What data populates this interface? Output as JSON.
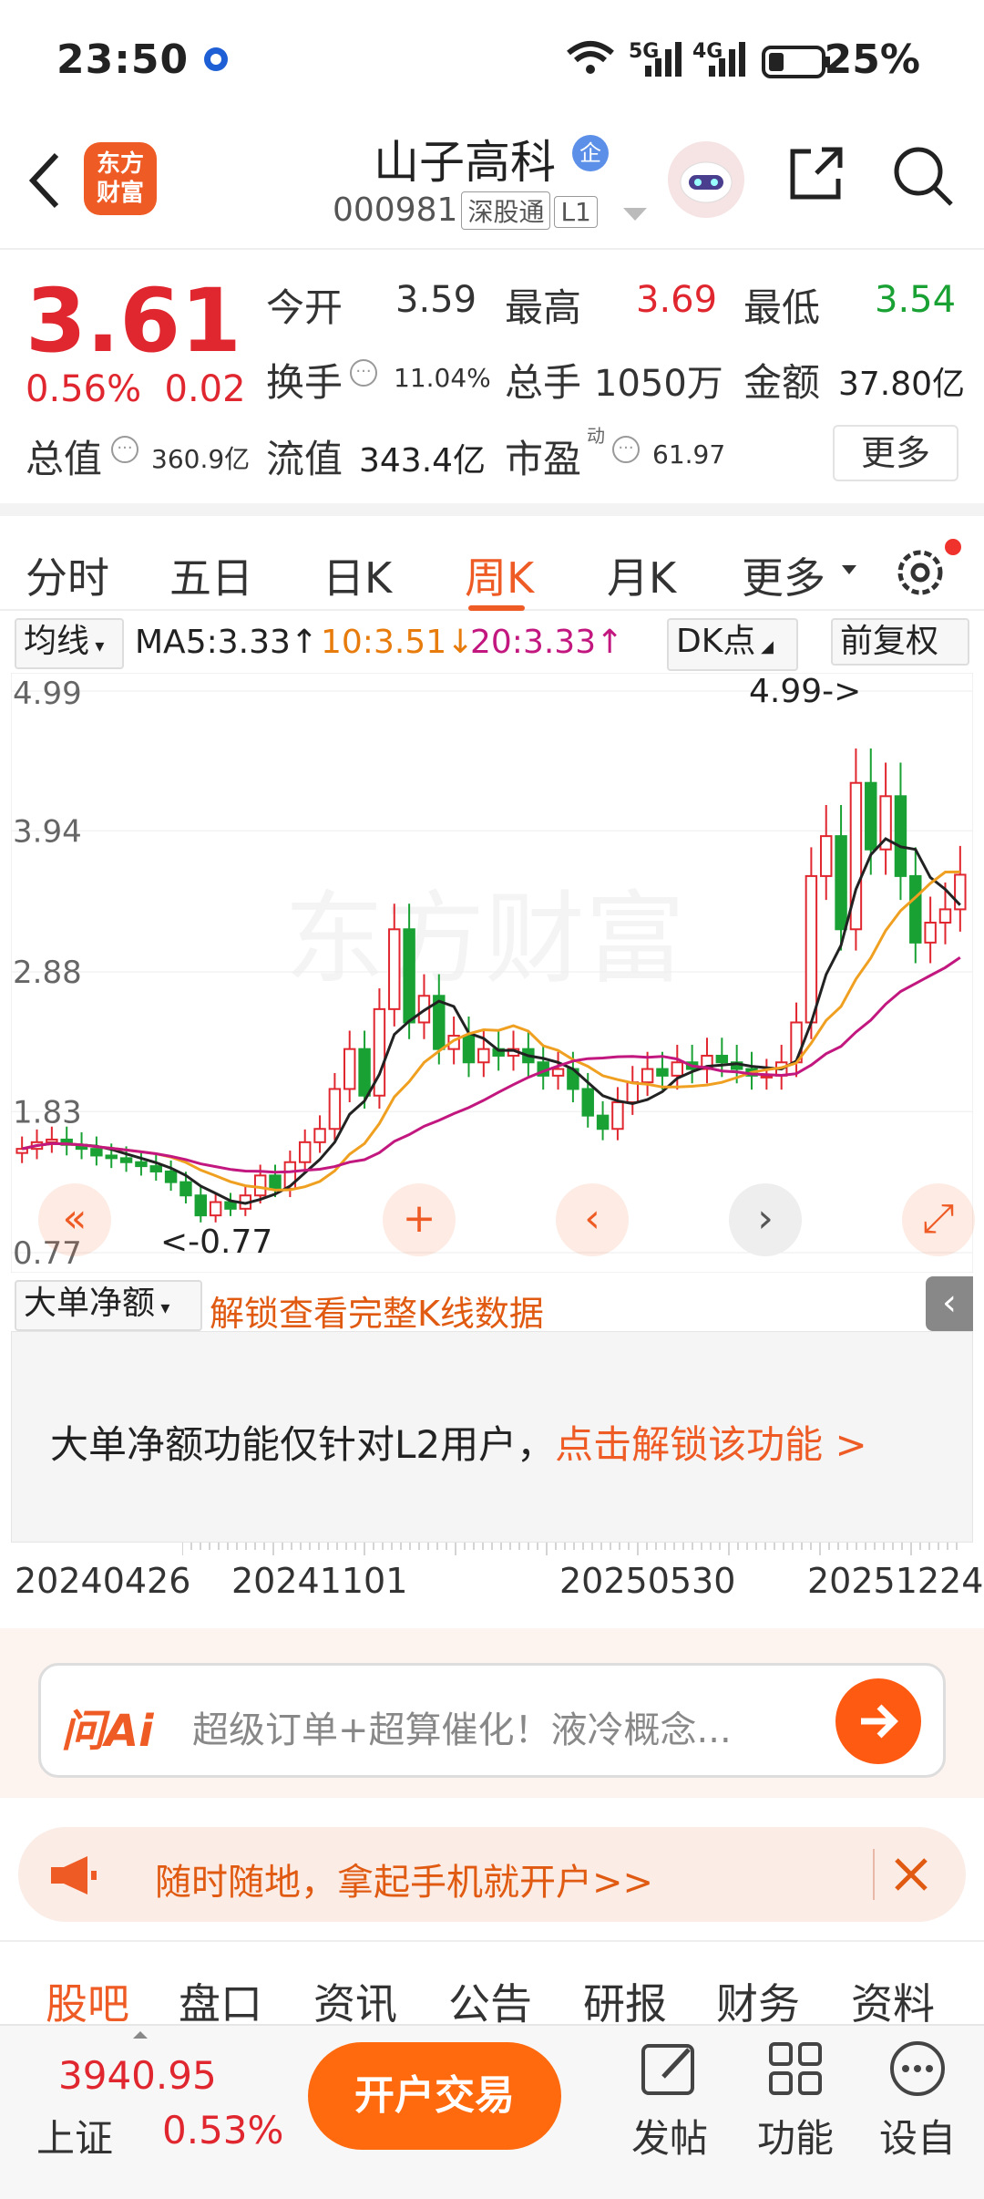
{
  "status_bar": {
    "time": "23:50",
    "battery": "25%",
    "net1": "5G",
    "net2": "4G"
  },
  "header": {
    "logo_text": "东方\n财富",
    "stock_name": "山子高科",
    "stock_name_badge": "企",
    "stock_code": "000981",
    "tag_connect": "深股通",
    "tag_level": "L1"
  },
  "quote": {
    "price": "3.61",
    "change_pct": "0.56%",
    "change": "0.02",
    "open_label": "今开",
    "open": "3.59",
    "high_label": "最高",
    "high": "3.69",
    "low_label": "最低",
    "low": "3.54",
    "turnover_label": "换手",
    "turnover": "11.04%",
    "volume_label": "总手",
    "volume": "1050万",
    "amount_label": "金额",
    "amount": "37.80亿",
    "mcap_label": "总值",
    "mcap": "360.9亿",
    "float_label": "流值",
    "float": "343.4亿",
    "pe_label": "市盈",
    "pe_sup": "动",
    "pe": "61.97",
    "more": "更多"
  },
  "tabs": [
    "分时",
    "五日",
    "日K",
    "周K",
    "月K",
    "更多"
  ],
  "active_tab": "周K",
  "ma_bar": {
    "selector": "均线",
    "ma5": "MA5:3.33↑",
    "ma10": "10:3.51↓",
    "ma20": "20:3.33↑",
    "dk": "DK点",
    "adjust": "前复权"
  },
  "colors": {
    "accent": "#ef5b25",
    "up": "#e0262e",
    "down": "#19a134",
    "ma5": "#222222",
    "ma10": "#f0a020",
    "ma20": "#c2177f"
  },
  "chart_data": {
    "type": "candlestick",
    "y_ticks": [
      "4.99",
      "3.94",
      "2.88",
      "1.83",
      "0.77"
    ],
    "ylim": [
      0.77,
      4.99
    ],
    "max_annotation": "4.99->",
    "min_annotation": "<-0.77",
    "watermark": "东方财富",
    "x_ticks": [
      "20240426",
      "20241101",
      "20250530",
      "20251224"
    ],
    "closes": [
      1.55,
      1.6,
      1.62,
      1.58,
      1.55,
      1.5,
      1.48,
      1.45,
      1.42,
      1.38,
      1.3,
      1.2,
      1.05,
      1.15,
      1.1,
      1.2,
      1.35,
      1.25,
      1.45,
      1.6,
      1.7,
      2.0,
      2.3,
      1.95,
      2.6,
      3.2,
      2.5,
      2.7,
      2.3,
      2.4,
      2.2,
      2.3,
      2.25,
      2.3,
      2.2,
      2.1,
      2.15,
      2.0,
      1.8,
      1.7,
      1.9,
      2.05,
      2.15,
      2.1,
      2.2,
      2.15,
      2.25,
      2.2,
      2.15,
      2.1,
      2.1,
      2.2,
      2.5,
      3.6,
      3.9,
      3.2,
      4.3,
      3.8,
      4.2,
      3.6,
      3.1,
      3.25,
      3.35,
      3.61
    ],
    "ma5_shape": "line",
    "ma10_shape": "line",
    "ma20_shape": "line"
  },
  "big_deal": {
    "selector": "大单净额",
    "unlock_link": "解锁查看完整K线数据",
    "notice_text": "大单净额功能仅针对L2用户，",
    "notice_link": "点击解锁该功能 >"
  },
  "ai": {
    "brand": "问Ai",
    "prompt": "超级订单+超算催化！液冷概念..."
  },
  "ad": {
    "text": "随时随地，拿起手机就开户>>"
  },
  "bottom_tabs": [
    "股吧",
    "盘口",
    "资讯",
    "公告",
    "研报",
    "财务",
    "资料"
  ],
  "active_bottom_tab": "股吧",
  "footer": {
    "index_value": "3940.95",
    "index_name": "上证",
    "index_change": "0.53%",
    "trade_button": "开户交易",
    "post": "发帖",
    "functions": "功能",
    "custom": "设自"
  }
}
